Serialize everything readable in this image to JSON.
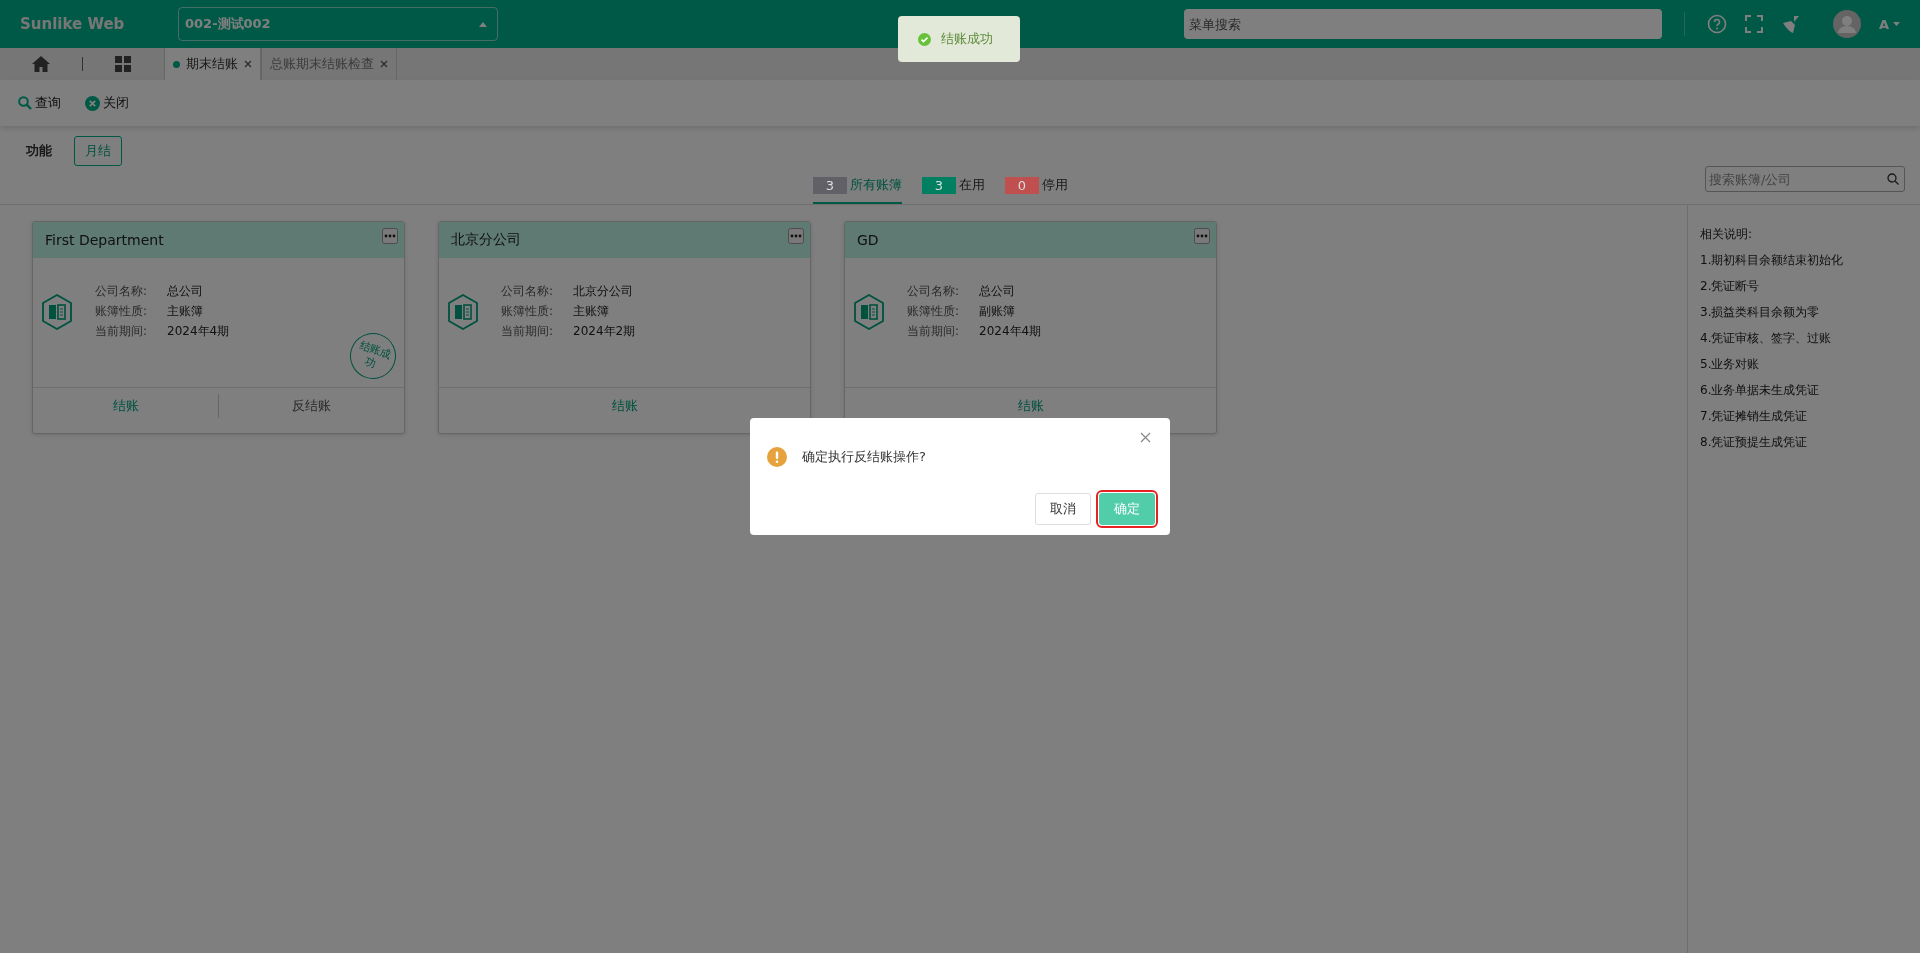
{
  "app": {
    "brand": "Sunlike Web",
    "account_select": "002-测试002",
    "menu_search": {
      "placeholder": "菜单搜索"
    },
    "user": "A"
  },
  "toast": {
    "kind": "success",
    "text": "结账成功"
  },
  "nav_icons": [
    {
      "kind": "home"
    },
    {
      "kind": "grid"
    }
  ],
  "tabs": [
    {
      "label": "期末结账",
      "selected": true
    },
    {
      "label": "总账期末结账检查",
      "selected": false
    }
  ],
  "toolbar": [
    {
      "kind": "search",
      "label": "查询"
    },
    {
      "kind": "close",
      "label": "关闭"
    }
  ],
  "function_bar": {
    "label": "功能",
    "buttons": [
      "月结"
    ]
  },
  "filters": [
    {
      "count": "3",
      "label": "所有账簿",
      "color": "#606066",
      "selected": true
    },
    {
      "count": "3",
      "label": "在用",
      "color": "#008060",
      "selected": false
    },
    {
      "count": "0",
      "label": "停用",
      "color": "#c05050",
      "selected": false
    }
  ],
  "ledger_search": {
    "placeholder": "搜索账簿/公司"
  },
  "cards": [
    {
      "title": "First Department",
      "fields": [
        {
          "label": "公司名称:",
          "value": "总公司"
        },
        {
          "label": "账簿性质:",
          "value": "主账簿"
        },
        {
          "label": "当前期间:",
          "value": "2024年4期"
        }
      ],
      "stamp": "结账成功",
      "actions": [
        {
          "label": "结账",
          "kind": "primary"
        },
        {
          "label": "反结账",
          "kind": "default"
        }
      ]
    },
    {
      "title": "北京分公司",
      "fields": [
        {
          "label": "公司名称:",
          "value": "北京分公司"
        },
        {
          "label": "账簿性质:",
          "value": "主账簿"
        },
        {
          "label": "当前期间:",
          "value": "2024年2期"
        }
      ],
      "actions": [
        {
          "label": "结账",
          "kind": "primary"
        }
      ]
    },
    {
      "title": "GD",
      "fields": [
        {
          "label": "公司名称:",
          "value": "总公司"
        },
        {
          "label": "账簿性质:",
          "value": "副账簿"
        },
        {
          "label": "当前期间:",
          "value": "2024年4期"
        }
      ],
      "actions": [
        {
          "label": "结账",
          "kind": "primary"
        }
      ]
    }
  ],
  "notes": {
    "title": "相关说明:",
    "items": [
      "1.期初科目余额结束初始化",
      "2.凭证断号",
      "3.损益类科目余额为零",
      "4.凭证审核、签字、过账",
      "5.业务对账",
      "6.业务单据未生成凭证",
      "7.凭证摊销生成凭证",
      "8.凭证预提生成凭证"
    ]
  },
  "dialog": {
    "message": "确定执行反结账操作?",
    "buttons": [
      {
        "label": "取消",
        "kind": "default",
        "highlighted": false
      },
      {
        "label": "确定",
        "kind": "primary",
        "highlighted": true
      }
    ]
  }
}
